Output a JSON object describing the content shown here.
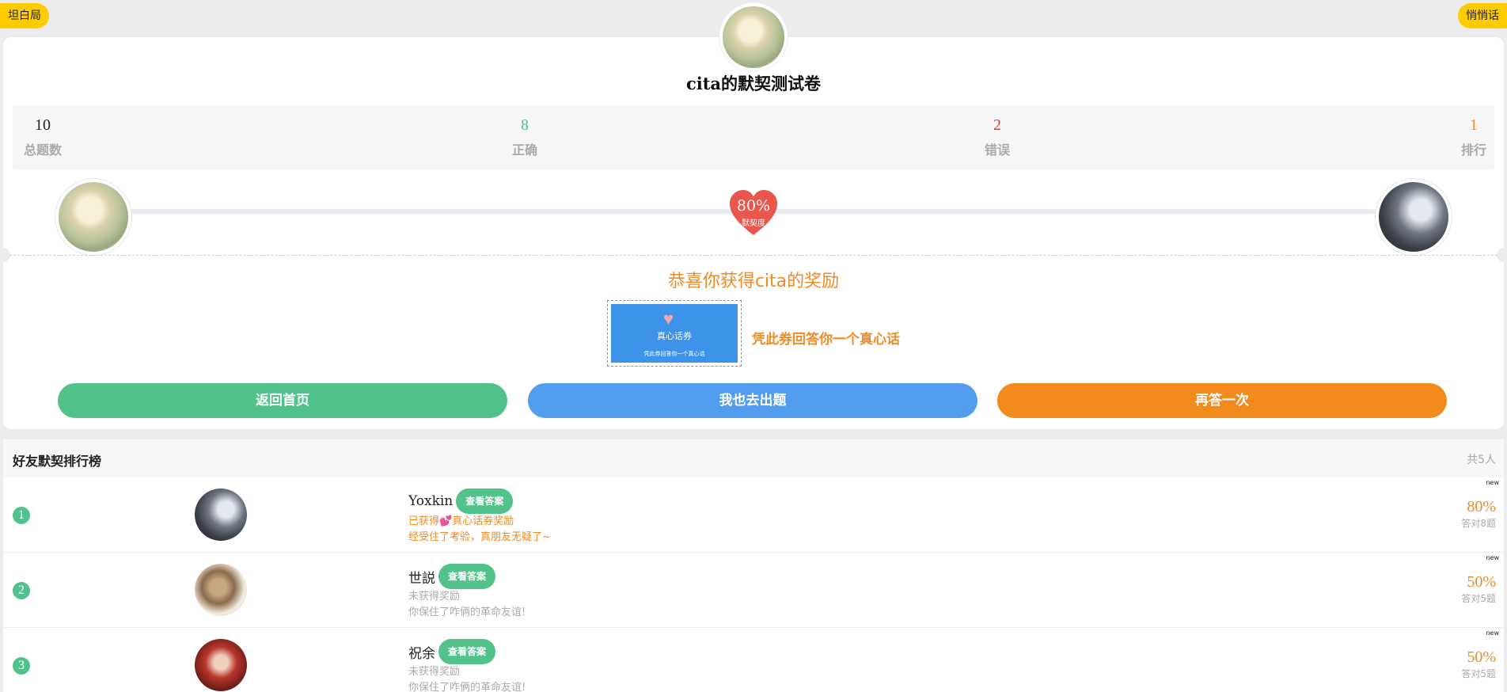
{
  "header": {
    "left_pill": "坦白局",
    "right_pill": "悄悄话"
  },
  "card": {
    "title": "cita的默契测试卷",
    "stats": [
      {
        "value": "10",
        "label": "总题数"
      },
      {
        "value": "8",
        "label": "正确"
      },
      {
        "value": "2",
        "label": "错误"
      },
      {
        "value": "1",
        "label": "排行"
      }
    ],
    "match": {
      "percent": "80%",
      "label": "默契度"
    },
    "reward": {
      "title": "恭喜你获得cita的奖励",
      "coupon_title": "真心话券",
      "coupon_sub": "凭此券回答你一个真心话",
      "text": "凭此券回答你一个真心话"
    },
    "buttons": {
      "home": "返回首页",
      "create": "我也去出题",
      "retry": "再答一次"
    }
  },
  "ranking": {
    "title": "好友默契排行榜",
    "count": "共5人",
    "view_label": "查看答案",
    "new_tag": "new",
    "rows": [
      {
        "rank": "1",
        "name": "Yoxkin",
        "line1_prefix": "已获得",
        "line1_icon": "💕",
        "line1_suffix": "真心话券奖励",
        "line2": "经受住了考验，真朋友无疑了~",
        "percent": "80%",
        "sub": "答对8题",
        "highlight": true
      },
      {
        "rank": "2",
        "name": "世説",
        "line1_prefix": "未获得奖励",
        "line1_icon": "",
        "line1_suffix": "",
        "line2": "你保住了咋俩的革命友谊!",
        "percent": "50%",
        "sub": "答对5题",
        "highlight": false
      },
      {
        "rank": "3",
        "name": "祝余",
        "line1_prefix": "未获得奖励",
        "line1_icon": "",
        "line1_suffix": "",
        "line2": "你保住了咋俩的革命友谊!",
        "percent": "50%",
        "sub": "答对5题",
        "highlight": false
      }
    ]
  },
  "colors": {
    "green": "#51c28a",
    "blue": "#539def",
    "orange": "#f38a1c",
    "yellow": "#ffcc00",
    "red": "#e53935"
  }
}
